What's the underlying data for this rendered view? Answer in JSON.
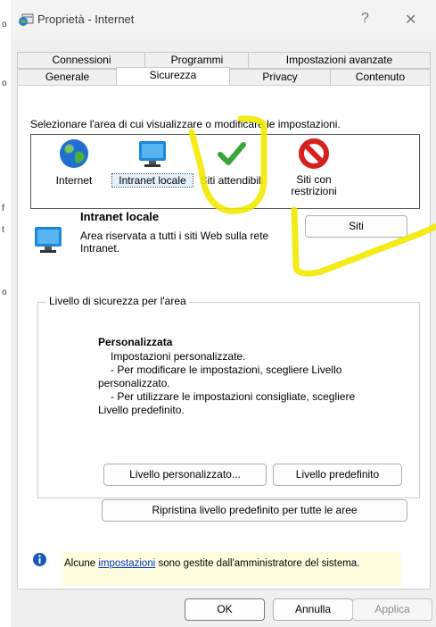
{
  "window": {
    "title": "Proprietà - Internet",
    "help_glyph": "?",
    "close_glyph": "✕"
  },
  "background_chars": [
    "o",
    "o",
    "f",
    "t",
    "o"
  ],
  "tabs": {
    "row_back": [
      "Connessioni",
      "Programmi",
      "Impostazioni avanzate"
    ],
    "row_front": [
      "Generale",
      "Sicurezza",
      "Privacy",
      "Contenuto"
    ],
    "active": "Sicurezza"
  },
  "security": {
    "instruction": "Selezionare l'area di cui visualizzare o modificare le impostazioni.",
    "zones": [
      {
        "label": "Internet",
        "icon": "globe-icon"
      },
      {
        "label": "Intranet locale",
        "icon": "monitor-icon"
      },
      {
        "label": "Siti attendibili",
        "icon": "checkmark-icon"
      },
      {
        "label": "Siti con restrizioni",
        "icon": "prohibited-icon"
      }
    ],
    "selected_zone": {
      "title": "Intranet locale",
      "description": "Area riservata a tutti i siti Web sulla rete Intranet."
    },
    "sites_button": "Siti",
    "level_group_title": "Livello di sicurezza per l'area",
    "level": {
      "name": "Personalizzata",
      "lines": [
        "Impostazioni personalizzate.",
        "- Per modificare le impostazioni, scegliere Livello",
        "personalizzato.",
        "- Per utilizzare le impostazioni consigliate, scegliere",
        "Livello predefinito."
      ]
    },
    "custom_level_button": "Livello personalizzato...",
    "default_level_button": "Livello predefinito",
    "reset_all_button": "Ripristina livello predefinito per tutte le aree",
    "admin_note": {
      "prefix": "Alcune ",
      "link": "impostazioni",
      "suffix": " sono gestite dall'amministratore del sistema."
    }
  },
  "footer": {
    "ok": "OK",
    "cancel": "Annulla",
    "apply": "Applica"
  },
  "colors": {
    "highlight": "#f2ea00",
    "accent": "#0067c0",
    "link": "#0033cc"
  }
}
